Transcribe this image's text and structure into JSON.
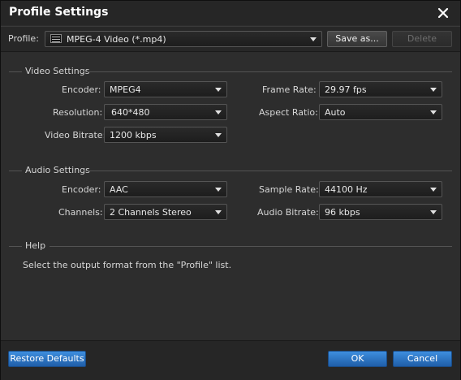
{
  "window": {
    "title": "Profile Settings"
  },
  "profile": {
    "label": "Profile:",
    "value": "MPEG-4 Video (*.mp4)",
    "icon": "mpeg4-file-icon",
    "save_as_label": "Save as...",
    "delete_label": "Delete"
  },
  "video_settings": {
    "heading": "Video Settings",
    "encoder_label": "Encoder:",
    "encoder_value": "MPEG4",
    "resolution_label": "Resolution:",
    "resolution_value": "640*480",
    "bitrate_label": "Video Bitrate:",
    "bitrate_value": "1200 kbps",
    "frame_rate_label": "Frame Rate:",
    "frame_rate_value": "29.97 fps",
    "aspect_ratio_label": "Aspect Ratio:",
    "aspect_ratio_value": "Auto"
  },
  "audio_settings": {
    "heading": "Audio Settings",
    "encoder_label": "Encoder:",
    "encoder_value": "AAC",
    "channels_label": "Channels:",
    "channels_value": "2 Channels Stereo",
    "sample_rate_label": "Sample Rate:",
    "sample_rate_value": "44100 Hz",
    "bitrate_label": "Audio Bitrate:",
    "bitrate_value": "96 kbps"
  },
  "help": {
    "heading": "Help",
    "text": "Select the output format from the \"Profile\" list."
  },
  "footer": {
    "restore_label": "Restore Defaults",
    "ok_label": "OK",
    "cancel_label": "Cancel"
  },
  "colors": {
    "accent": "#2a74c4",
    "background": "#2d2d2d",
    "text": "#d6d6d6"
  }
}
